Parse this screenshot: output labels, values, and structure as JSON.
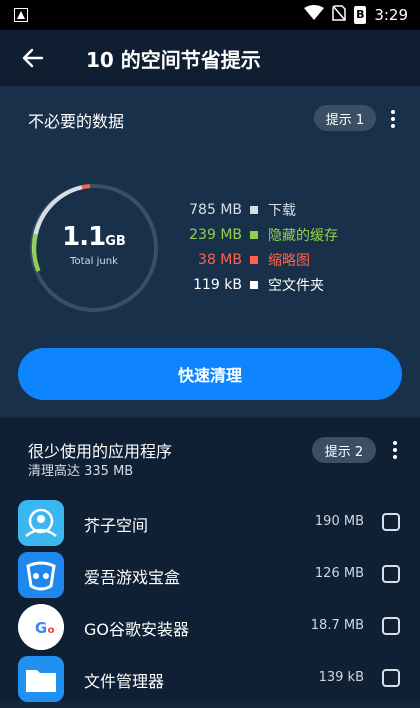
{
  "status_bar": {
    "time": "3:29",
    "battery_level": "B"
  },
  "header": {
    "title": "10 的空间节省提示"
  },
  "section1": {
    "title": "不必要的数据",
    "tip_label": "提示 1",
    "gauge": {
      "value": "1.1",
      "unit": "GB",
      "caption": "Total junk"
    },
    "legend": [
      {
        "size": "785 MB",
        "label": "下载",
        "color": "#d7dde4"
      },
      {
        "size": "239 MB",
        "label": "隐藏的缓存",
        "color": "#8fd14f"
      },
      {
        "size": "38 MB",
        "label": "缩略图",
        "color": "#ff6347"
      },
      {
        "size": "119 kB",
        "label": "空文件夹",
        "color": "#ffffff"
      }
    ],
    "clean_button": "快速清理"
  },
  "section2": {
    "title": "很少使用的应用程序",
    "subtitle": "清理高达 335 MB",
    "tip_label": "提示 2",
    "apps": [
      {
        "name": "芥子空间",
        "size": "190 MB",
        "icon": "mustard-space-icon"
      },
      {
        "name": "爱吾游戏宝盒",
        "size": "126 MB",
        "icon": "game-box-icon"
      },
      {
        "name": "GO谷歌安装器",
        "size": "18.7 MB",
        "icon": "google-installer-icon"
      },
      {
        "name": "文件管理器",
        "size": "139 kB",
        "icon": "folder-icon"
      }
    ]
  }
}
